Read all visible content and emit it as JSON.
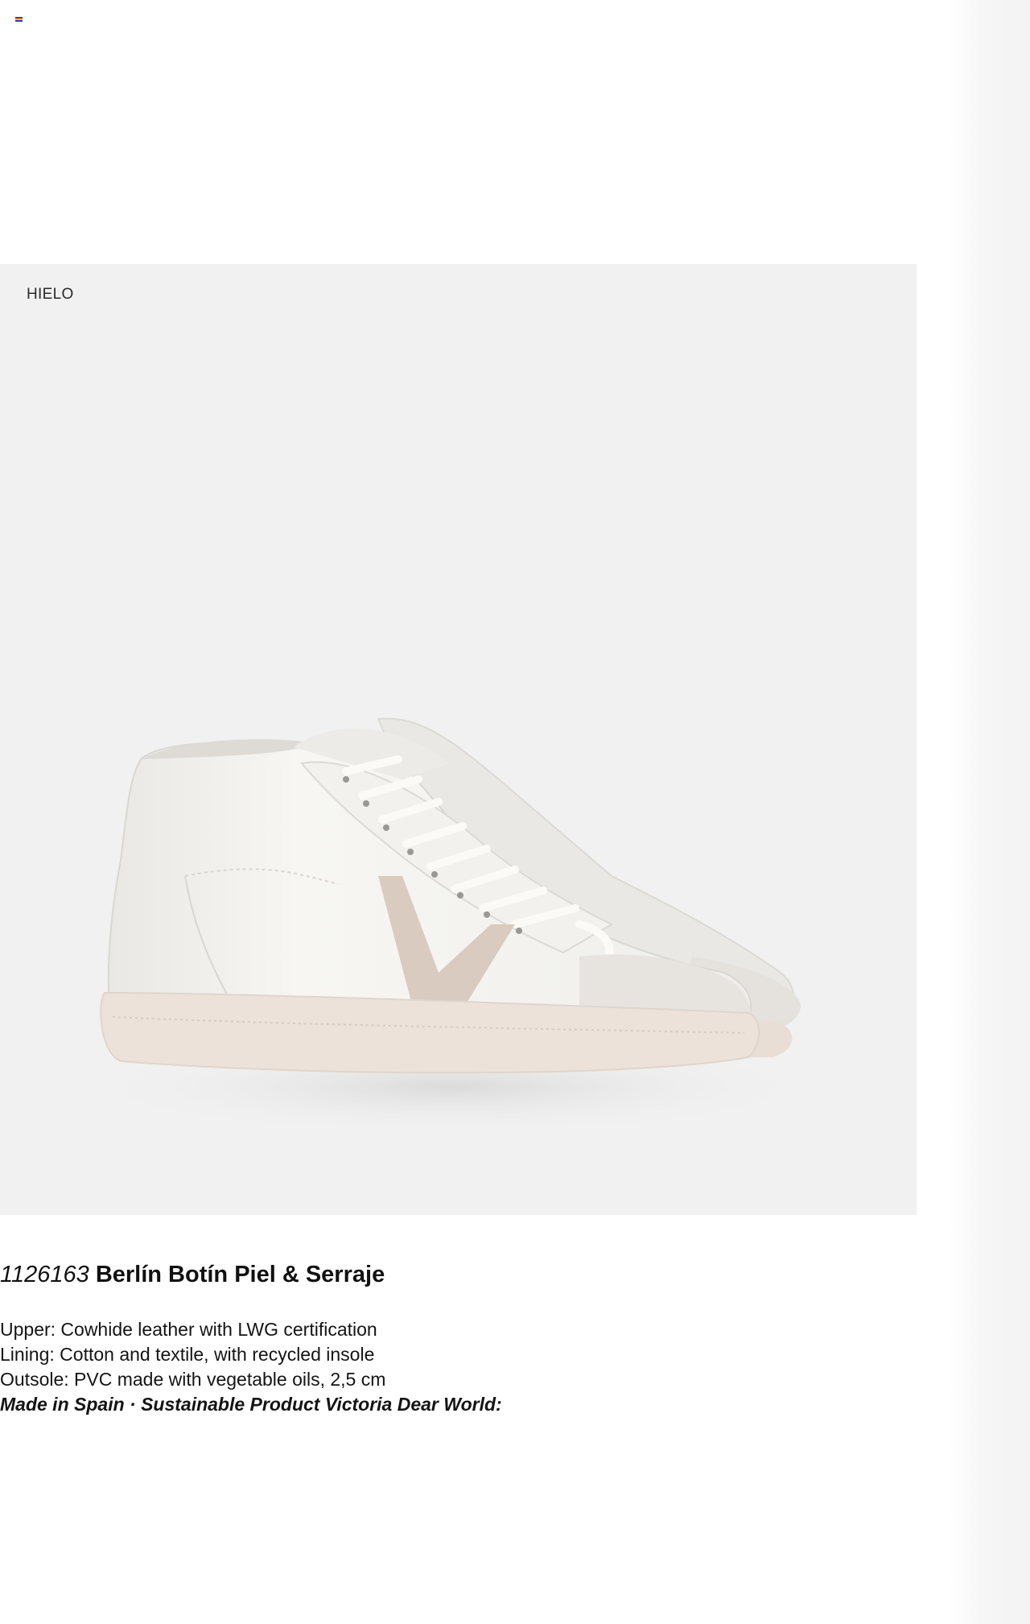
{
  "product": {
    "color": "HIELO",
    "code": "1126163",
    "name": "Berlín Botín Piel & Serraje",
    "specs": [
      "Upper: Cowhide leather with LWG certification",
      "Lining: Cotton and textile, with recycled insole",
      "Outsole: PVC made with vegetable oils, 2,5 cm"
    ],
    "tagline": "Made in Spain · Sustainable Product Victoria Dear World:"
  },
  "icons": {
    "flag": "spain-flag-icon"
  },
  "colors": {
    "photo_background": "#f1f1f1",
    "leather": "#f3f2ef",
    "v_logo": "#d9cbbf",
    "sole": "#ece2da"
  }
}
